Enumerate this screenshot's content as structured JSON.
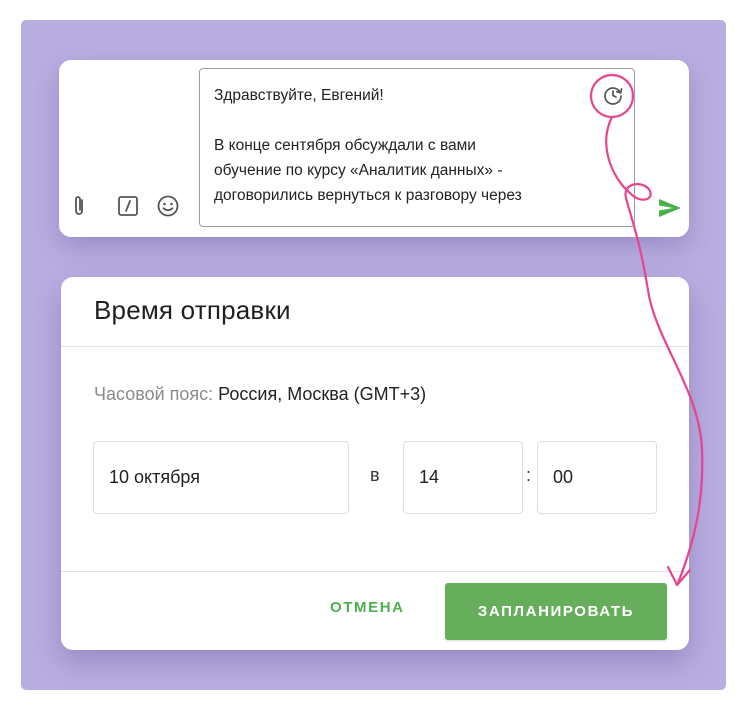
{
  "composer": {
    "message_lines": [
      "Здравствуйте, Евгений!",
      "",
      "В конце сентября обсуждали с вами",
      "обучение по курсу «Аналитик данных» -",
      "договорились вернуться к разговору через"
    ],
    "icons": {
      "attach": "paperclip-icon",
      "template": "slash-command-icon",
      "emoji": "emoji-icon",
      "schedule": "schedule-clock-icon",
      "send": "send-arrow-icon"
    }
  },
  "dialog": {
    "title": "Время отправки",
    "timezone_label": "Часовой пояс:",
    "timezone_value": "Россия, Москва (GMT+3)",
    "date_value": "10 октября",
    "at_label": "в",
    "hour_value": "14",
    "colon": ":",
    "minute_value": "00",
    "cancel_label": "ОТМЕНА",
    "schedule_label": "ЗАПЛАНИРОВАТЬ"
  },
  "colors": {
    "backdrop": "#b9aee1",
    "accent_green": "#66ae5c",
    "send_green": "#4caf50",
    "annotation_pink": "#e8438d"
  }
}
